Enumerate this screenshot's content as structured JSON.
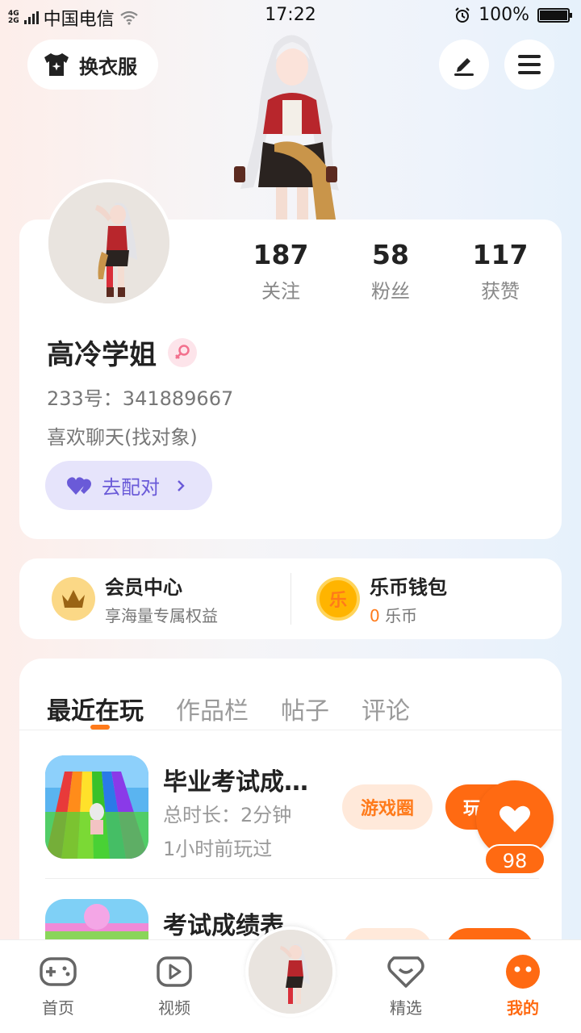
{
  "status_bar": {
    "network_top": "4G",
    "network_bottom": "2G",
    "carrier": "中国电信",
    "time": "17:22",
    "battery": "100%"
  },
  "header": {
    "change_clothes": "换衣服"
  },
  "profile": {
    "stats": [
      {
        "count": "187",
        "label": "关注"
      },
      {
        "count": "58",
        "label": "粉丝"
      },
      {
        "count": "117",
        "label": "获赞"
      }
    ],
    "name": "高冷学姐",
    "uid": "233号：341889667",
    "bio": "喜欢聊天(找对象)",
    "pair_button": "去配对"
  },
  "vip": {
    "member_title": "会员中心",
    "member_sub": "享海量专属权益",
    "wallet_title": "乐币钱包",
    "wallet_icon_char": "乐",
    "wallet_amount": "0",
    "wallet_unit": "乐币"
  },
  "tabs": [
    "最近在玩",
    "作品栏",
    "帖子",
    "评论"
  ],
  "games": [
    {
      "title": "毕业考试成…",
      "duration": "总时长：2分钟",
      "last_played": "1小时前玩过",
      "circle_button": "游戏圈",
      "play_button": "玩"
    },
    {
      "title": "考试成绩表",
      "duration": "",
      "last_played": "",
      "circle_button": "",
      "play_button": ""
    }
  ],
  "floating_like": {
    "count": "98"
  },
  "bottom_nav": [
    {
      "label": "首页",
      "icon": "gamepad-icon"
    },
    {
      "label": "视频",
      "icon": "video-icon"
    },
    {
      "label": "精选",
      "icon": "selected-icon"
    },
    {
      "label": "我的",
      "icon": "profile-face-icon"
    }
  ],
  "colors": {
    "accent": "#ff6a12",
    "pair_purple": "#6a5ad8"
  }
}
